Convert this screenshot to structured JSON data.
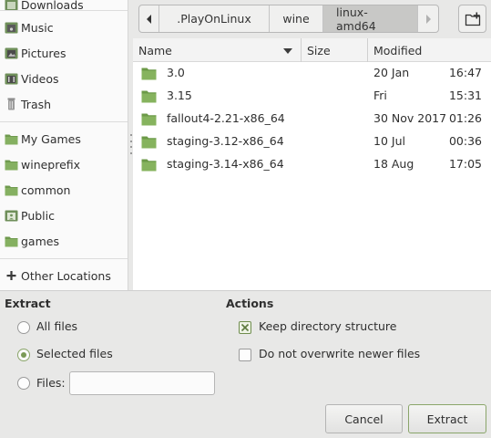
{
  "sidebar": {
    "items": [
      {
        "label": "Downloads",
        "icon": "download-folder-icon"
      },
      {
        "label": "Music",
        "icon": "music-folder-icon"
      },
      {
        "label": "Pictures",
        "icon": "pictures-folder-icon"
      },
      {
        "label": "Videos",
        "icon": "videos-folder-icon"
      },
      {
        "label": "Trash",
        "icon": "trash-icon"
      },
      {
        "label": "My Games",
        "icon": "folder-icon"
      },
      {
        "label": "wineprefix",
        "icon": "folder-icon"
      },
      {
        "label": "common",
        "icon": "folder-icon"
      },
      {
        "label": "Public",
        "icon": "public-folder-icon"
      },
      {
        "label": "games",
        "icon": "folder-icon"
      },
      {
        "label": "Other Locations",
        "icon": "plus-icon"
      }
    ]
  },
  "pathbar": {
    "crumbs": [
      ".PlayOnLinux",
      "wine",
      "linux-amd64"
    ],
    "active_index": 2
  },
  "filelist": {
    "columns": {
      "name": "Name",
      "size": "Size",
      "modified": "Modified"
    },
    "sort": "name-descending",
    "rows": [
      {
        "name": "3.0",
        "size": "",
        "date": "20 Jan",
        "time": "16:47"
      },
      {
        "name": "3.15",
        "size": "",
        "date": "Fri",
        "time": "15:31"
      },
      {
        "name": "fallout4-2.21-x86_64",
        "size": "",
        "date": "30 Nov 2017",
        "time": "01:26"
      },
      {
        "name": "staging-3.12-x86_64",
        "size": "",
        "date": "10 Jul",
        "time": "00:36"
      },
      {
        "name": "staging-3.14-x86_64",
        "size": "",
        "date": "18 Aug",
        "time": "17:05"
      }
    ]
  },
  "extract": {
    "title": "Extract",
    "options": [
      {
        "label": "All files",
        "checked": false
      },
      {
        "label": "Selected files",
        "checked": true
      },
      {
        "label": "Files:",
        "checked": false
      }
    ],
    "files_value": ""
  },
  "actions": {
    "title": "Actions",
    "keep_structure": {
      "label": "Keep directory structure",
      "checked": true
    },
    "no_overwrite": {
      "label": "Do not overwrite newer files",
      "checked": false
    }
  },
  "buttons": {
    "cancel": "Cancel",
    "extract": "Extract"
  },
  "colors": {
    "accent_green": "#8aa56a",
    "folder_green": "#7da857",
    "path_active": "#c8c8c6"
  }
}
